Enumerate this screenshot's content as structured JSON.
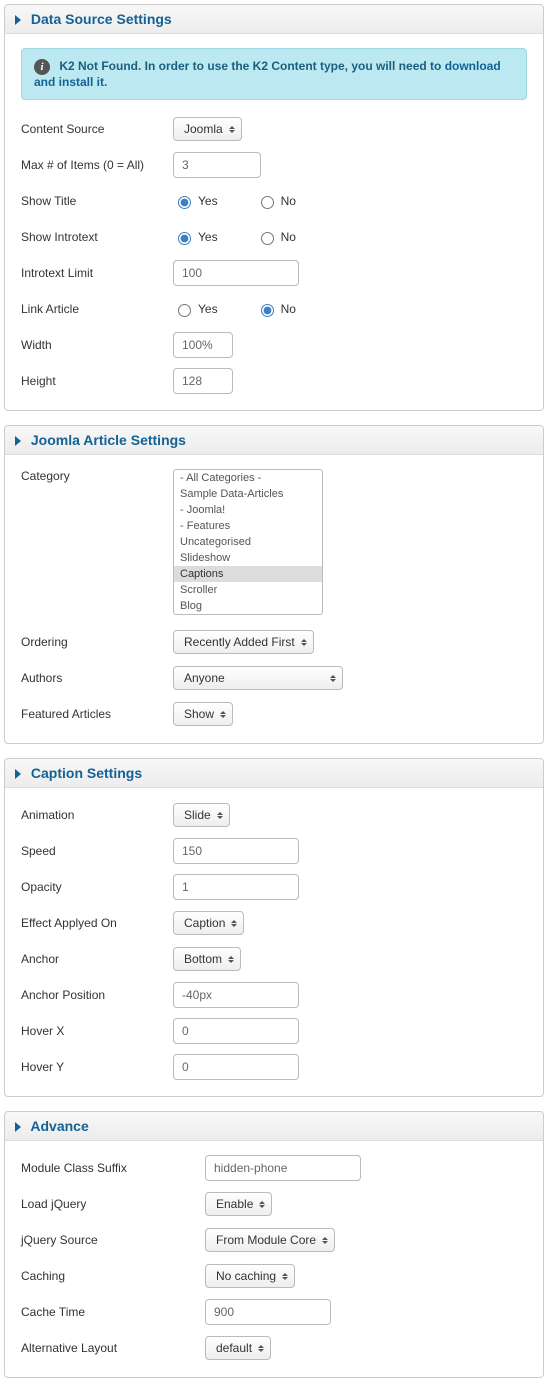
{
  "panel1": {
    "title": "Data Source Settings",
    "notice_strong": "K2 Not Found. In order to use the K2 Content type, you will need to ",
    "notice_link": "download and install it.",
    "content_source_label": "Content Source",
    "content_source_value": "Joomla",
    "max_items_label": "Max # of Items (0 = All)",
    "max_items_value": "3",
    "show_title_label": "Show Title",
    "show_introtext_label": "Show Introtext",
    "introtext_limit_label": "Introtext Limit",
    "introtext_limit_value": "100",
    "link_article_label": "Link Article",
    "width_label": "Width",
    "width_value": "100%",
    "height_label": "Height",
    "height_value": "128",
    "yes": "Yes",
    "no": "No"
  },
  "panel2": {
    "title": "Joomla Article Settings",
    "category_label": "Category",
    "categories": {
      "o0": "- All Categories -",
      "o1": "Sample Data-Articles",
      "o2": "- Joomla!",
      "o3": "- Features",
      "o4": "Uncategorised",
      "o5": "Slideshow",
      "o6": "Captions",
      "o7": "Scroller",
      "o8": "Blog"
    },
    "ordering_label": "Ordering",
    "ordering_value": "Recently Added First",
    "authors_label": "Authors",
    "authors_value": "Anyone",
    "featured_label": "Featured Articles",
    "featured_value": "Show"
  },
  "panel3": {
    "title": "Caption Settings",
    "animation_label": "Animation",
    "animation_value": "Slide",
    "speed_label": "Speed",
    "speed_value": "150",
    "opacity_label": "Opacity",
    "opacity_value": "1",
    "effect_label": "Effect Applyed On",
    "effect_value": "Caption",
    "anchor_label": "Anchor",
    "anchor_value": "Bottom",
    "anchor_pos_label": "Anchor Position",
    "anchor_pos_value": "-40px",
    "hoverx_label": "Hover X",
    "hoverx_value": "0",
    "hovery_label": "Hover Y",
    "hovery_value": "0"
  },
  "panel4": {
    "title": "Advance",
    "suffix_label": "Module Class Suffix",
    "suffix_value": "hidden-phone",
    "jquery_label": "Load jQuery",
    "jquery_value": "Enable",
    "jqsrc_label": "jQuery Source",
    "jqsrc_value": "From Module Core",
    "caching_label": "Caching",
    "caching_value": "No caching",
    "cachetime_label": "Cache Time",
    "cachetime_value": "900",
    "altlayout_label": "Alternative Layout",
    "altlayout_value": "default"
  }
}
